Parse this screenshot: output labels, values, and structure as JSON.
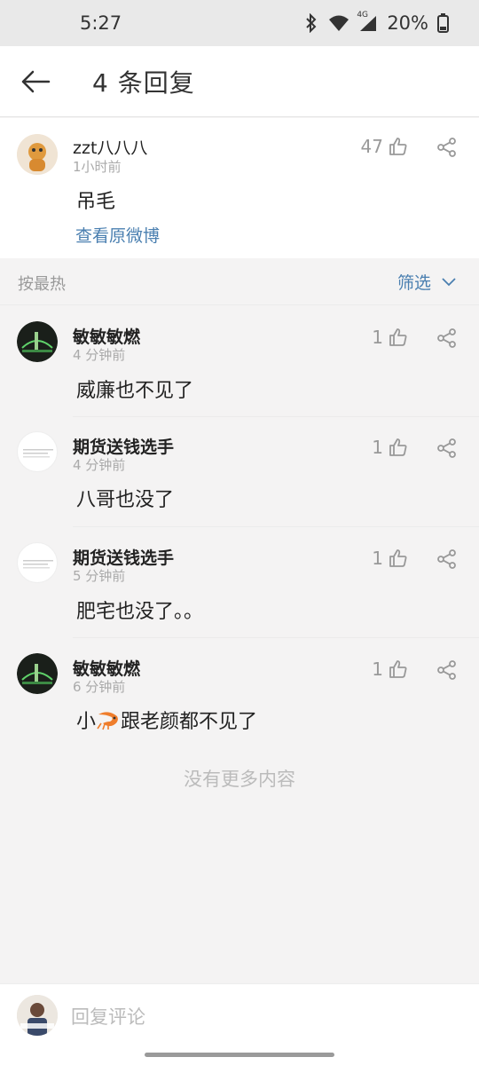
{
  "status_bar": {
    "time": "5:27",
    "network": "4G",
    "battery": "20%"
  },
  "header": {
    "title": "4 条回复"
  },
  "root_comment": {
    "name": "zzt八八八",
    "time": "1小时前",
    "text": "吊毛",
    "likes": "47",
    "view_original": "查看原微博"
  },
  "sort_bar": {
    "label": "按最热",
    "filter": "筛选"
  },
  "replies": [
    {
      "name": "敏敏敏燃",
      "time": "4 分钟前",
      "text": "威廉也不见了",
      "likes": "1"
    },
    {
      "name": "期货送钱选手",
      "time": "4 分钟前",
      "text": "八哥也没了",
      "likes": "1"
    },
    {
      "name": "期货送钱选手",
      "time": "5 分钟前",
      "text": "肥宅也没了。。",
      "likes": "1"
    },
    {
      "name": "敏敏敏燃",
      "time": "6 分钟前",
      "text_before": "小",
      "text_after": "跟老颜都不见了",
      "likes": "1"
    }
  ],
  "no_more": "没有更多内容",
  "bottom": {
    "placeholder": "回复评论"
  },
  "colors": {
    "link": "#4a7fb0",
    "muted": "#aaaaaa",
    "background": "#f4f3f3"
  }
}
